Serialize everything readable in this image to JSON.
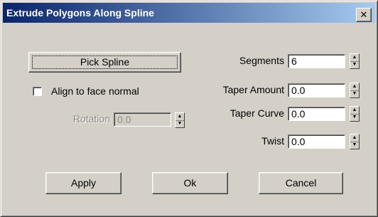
{
  "window": {
    "title": "Extrude Polygons Along Spline",
    "close_symbol": "✕"
  },
  "pick_spline": {
    "label": "Pick Spline"
  },
  "align": {
    "label": "Align to face normal",
    "checked": false
  },
  "rotation": {
    "label": "Rotation",
    "value": "0.0"
  },
  "params": {
    "segments": {
      "label": "Segments",
      "value": "6"
    },
    "taper_amount": {
      "label": "Taper Amount",
      "value": "0.0"
    },
    "taper_curve": {
      "label": "Taper Curve",
      "value": "0.0"
    },
    "twist": {
      "label": "Twist",
      "value": "0.0"
    }
  },
  "buttons": {
    "apply": "Apply",
    "ok": "Ok",
    "cancel": "Cancel"
  },
  "icons": {
    "spinner_up": "▲",
    "spinner_down": "▼"
  },
  "colors": {
    "dialog_bg": "#d4d0c8",
    "title_start": "#0a246a",
    "title_end": "#a6caf0"
  }
}
